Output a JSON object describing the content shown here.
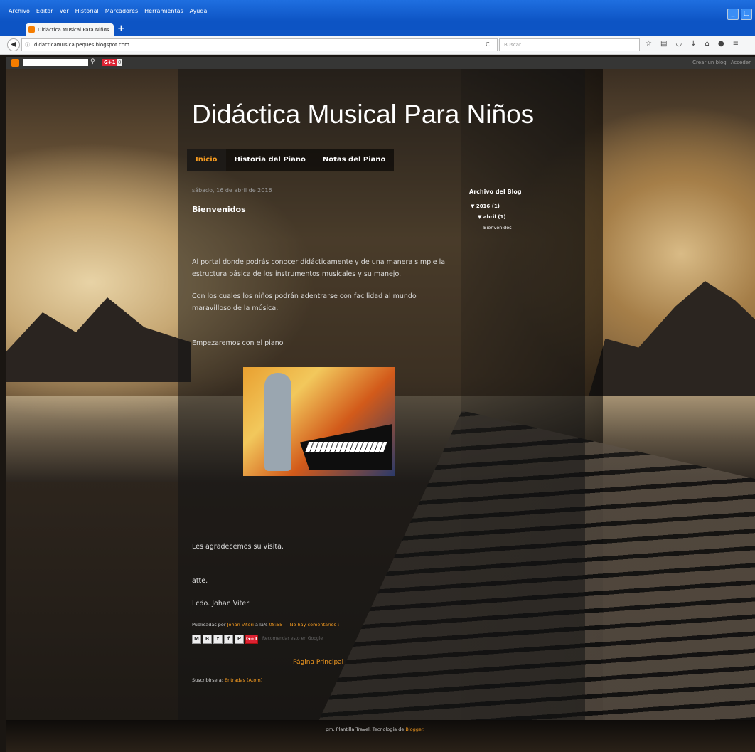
{
  "browser": {
    "menu": [
      "Archivo",
      "Editar",
      "Ver",
      "Historial",
      "Marcadores",
      "Herramientas",
      "Ayuda"
    ],
    "tab_title": "Didáctica Musical Para Niños",
    "tab_close": "×",
    "new_tab": "+",
    "url": "didacticamusicalpeques.blogspot.com",
    "search_placeholder": "Buscar",
    "window_buttons": [
      "_",
      "▢"
    ]
  },
  "blogger_bar": {
    "gplus": "G+1",
    "count": "0",
    "create_blog": "Crear un blog",
    "login": "Acceder"
  },
  "blog": {
    "title": "Didáctica Musical Para Niños",
    "tabs": [
      {
        "label": "Inicio",
        "active": true
      },
      {
        "label": "Historia del Piano",
        "active": false
      },
      {
        "label": "Notas del Piano",
        "active": false
      }
    ]
  },
  "post": {
    "date": "sábado, 16 de abril de 2016",
    "title": "Bienvenidos",
    "paragraphs": [
      "Al portal donde podrás conocer didácticamente y de una manera simple la estructura básica de los instrumentos musicales y su manejo.",
      "Con los cuales los niños podrán adentrarse con facilidad al mundo maravilloso de la música.",
      "Empezaremos con el piano",
      "Les agradecemos su visita.",
      "atte.",
      "Lcdo. Johan Viteri"
    ],
    "footer": {
      "published_by": "Publicadas por",
      "author": "Johan Viteri",
      "at": "a la/s",
      "time": "08:55",
      "comments": "No hay comentarios :"
    },
    "share_icons": [
      "M",
      "B",
      "t",
      "f",
      "P"
    ],
    "share_gplus": "G+1",
    "recommend": "Recomendar esto en Google",
    "home_link": "Página Principal",
    "subscribe_label": "Suscribirse a:",
    "subscribe_link": "Entradas (Atom)"
  },
  "sidebar": {
    "heading": "Archivo del Blog",
    "year": "▼ 2016 (1)",
    "month": "▼ abril (1)",
    "post": "Bienvenidos"
  },
  "credits": {
    "text": "pm. Plantilla Travel. Tecnología de",
    "link": "Blogger."
  }
}
